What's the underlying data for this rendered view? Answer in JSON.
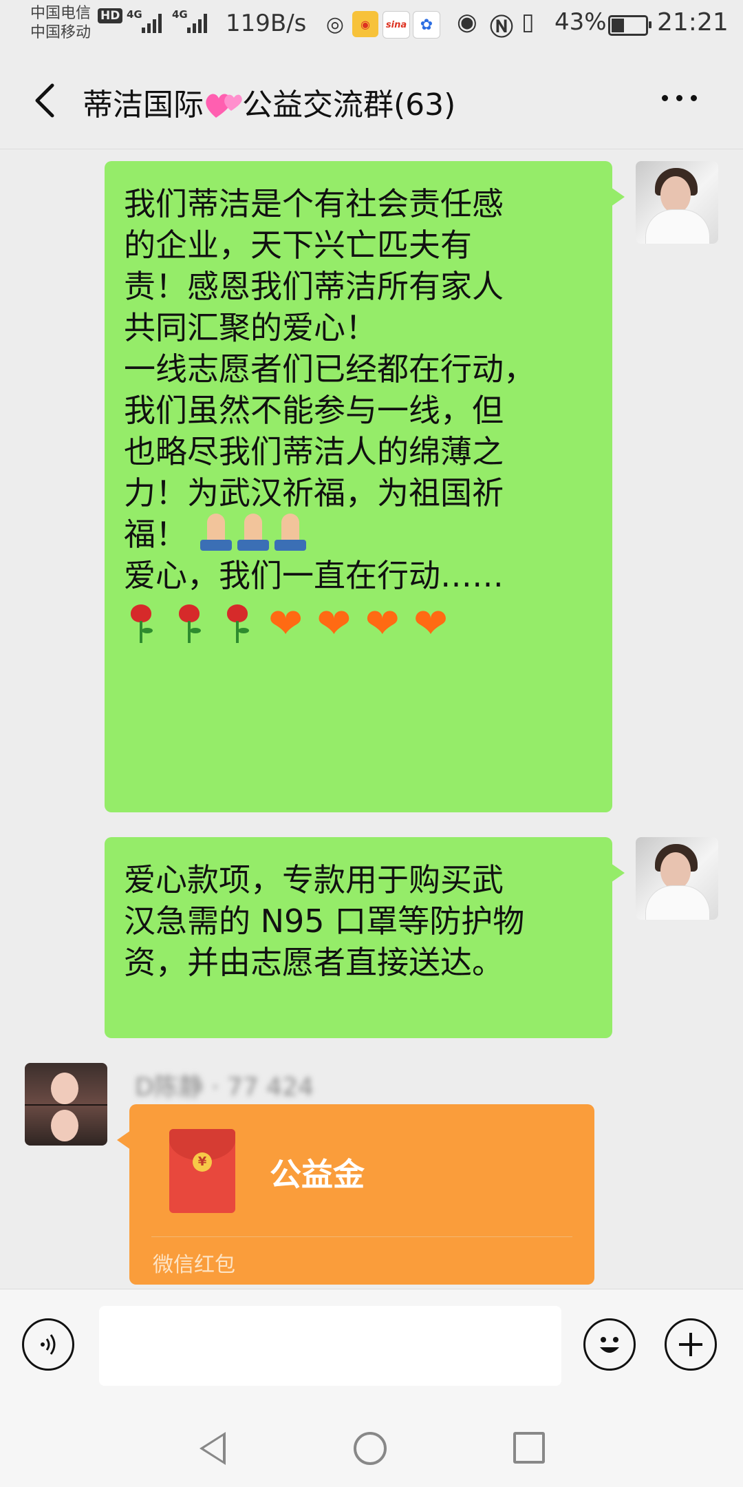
{
  "status_bar": {
    "carrier1": "中国电信",
    "carrier2": "中国移动",
    "hd_badge": "HD",
    "network1": "4G",
    "network2": "4G",
    "net_speed": "119B/s",
    "app_icons": [
      "wechat-icon",
      "weibo-icon",
      "sina-icon",
      "baidu-icon"
    ],
    "battery_level": "43%",
    "battery_fraction": 0.43,
    "time": "21:21"
  },
  "header": {
    "title_part1": "蒂洁国际",
    "title_part2": "公益交流群(63)",
    "emoji": "two-hearts-icon"
  },
  "messages": [
    {
      "side": "right",
      "lines": [
        "我们蒂洁是个有社会责任感",
        "的企业，天下兴亡匹夫有",
        "责！感恩我们蒂洁所有家人",
        "共同汇聚的爱心！",
        "一线志愿者们已经都在行动，",
        "我们虽然不能参与一线，但",
        "也略尽我们蒂洁人的绵薄之",
        "力！为武汉祈福，为祖国祈",
        "福！"
      ],
      "after_pray": "爱心，我们一直在行动……"
    },
    {
      "side": "right",
      "lines": [
        "爱心款项，专款用于购买武",
        "汉急需的 N95 口罩等防护物",
        "资，并由志愿者直接送达。"
      ]
    }
  ],
  "red_packet": {
    "sender_name": "D陈静 · 77    424",
    "title": "公益金",
    "footer": "微信红包",
    "currency_symbol": "¥"
  },
  "input_bar": {
    "voice_icon": "voice-icon",
    "emoji_icon": "smiley-icon",
    "plus_icon": "plus-icon"
  },
  "colors": {
    "bubble_green": "#95ec69",
    "red_packet_orange": "#fa9d3b",
    "background": "#ededed"
  }
}
